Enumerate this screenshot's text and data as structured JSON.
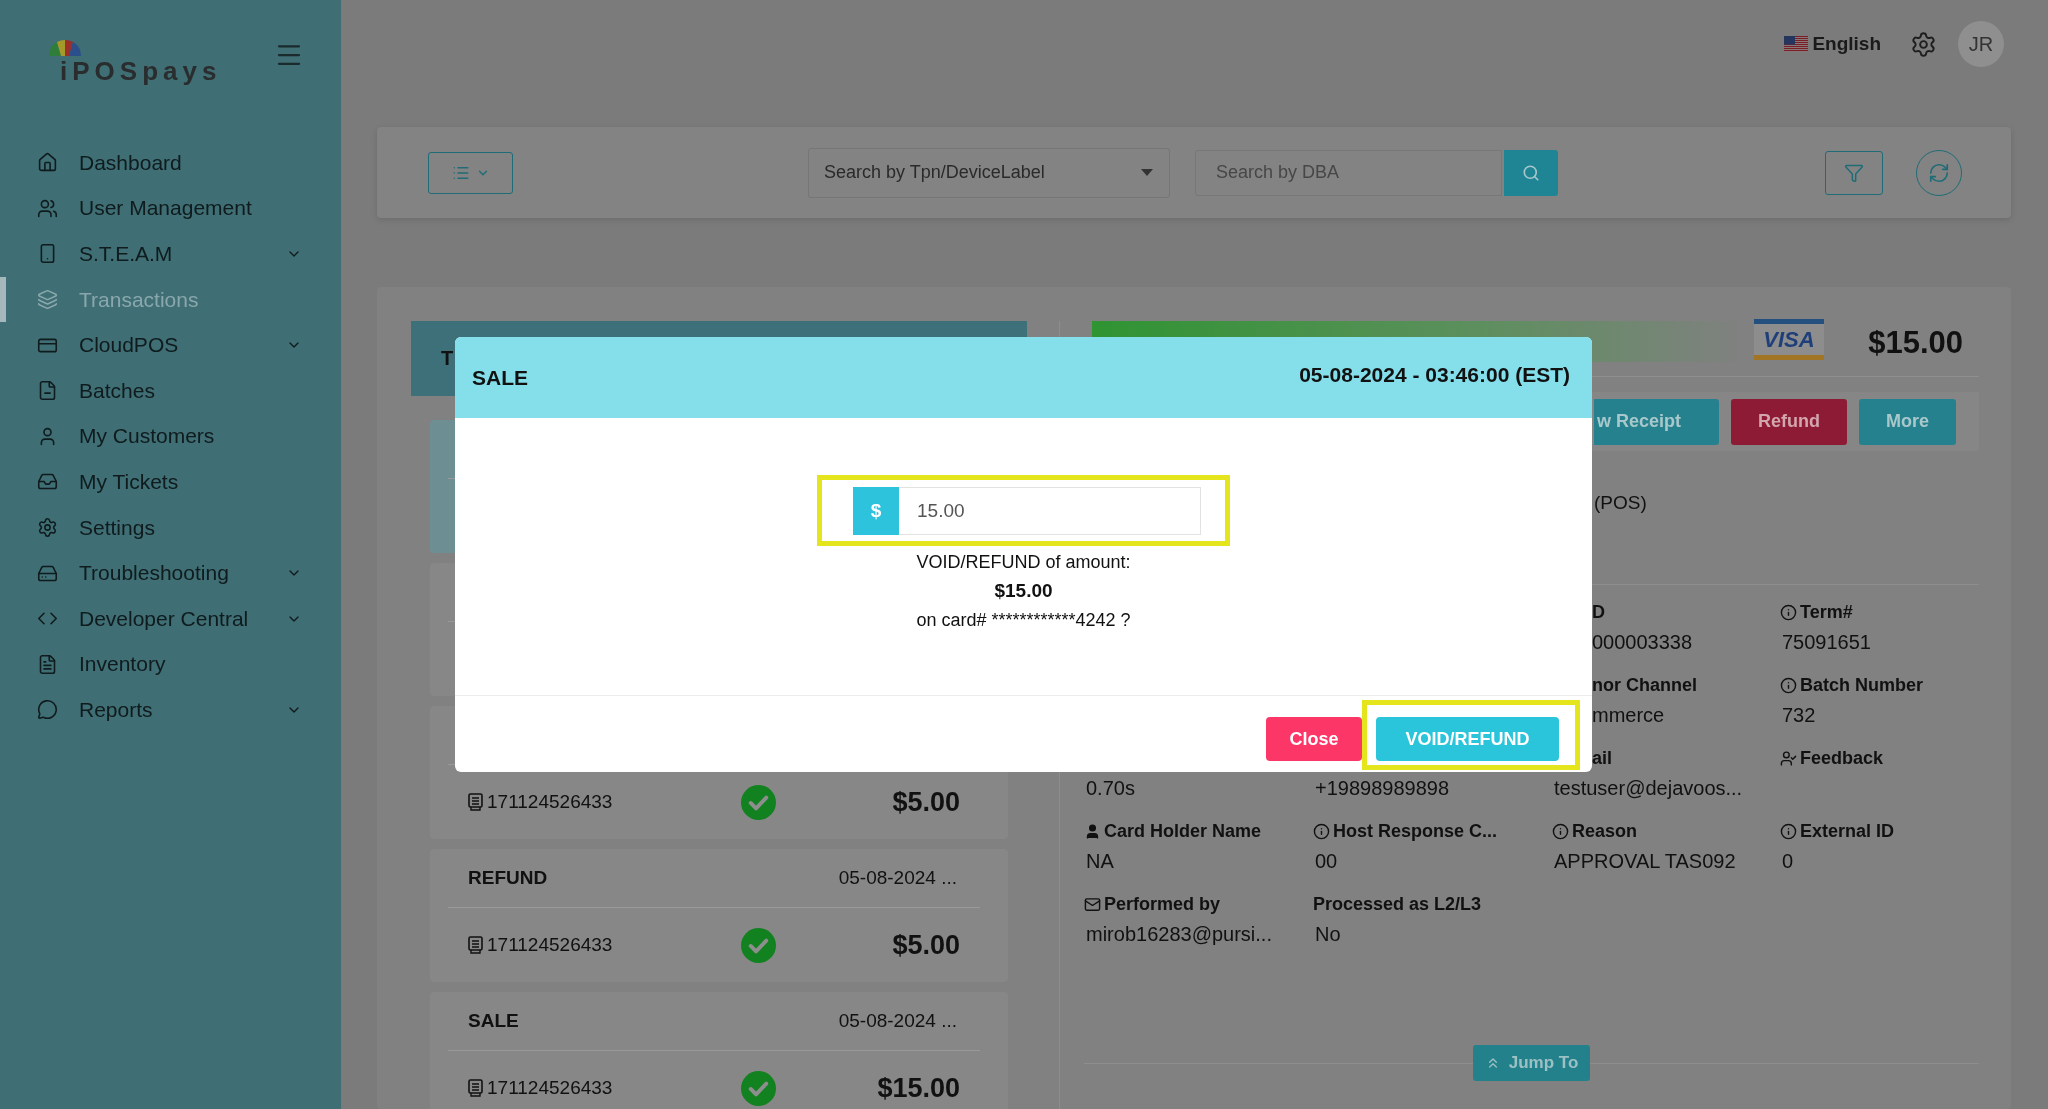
{
  "sidebar": {
    "logo": "iPOSpays",
    "items": [
      {
        "label": "Dashboard",
        "selected": false,
        "expandable": false
      },
      {
        "label": "User Management",
        "selected": false,
        "expandable": false
      },
      {
        "label": "S.T.E.A.M",
        "selected": false,
        "expandable": true
      },
      {
        "label": "Transactions",
        "selected": true,
        "expandable": false
      },
      {
        "label": "CloudPOS",
        "selected": false,
        "expandable": true
      },
      {
        "label": "Batches",
        "selected": false,
        "expandable": false
      },
      {
        "label": "My Customers",
        "selected": false,
        "expandable": false
      },
      {
        "label": "My Tickets",
        "selected": false,
        "expandable": false
      },
      {
        "label": "Settings",
        "selected": false,
        "expandable": false
      },
      {
        "label": "Troubleshooting",
        "selected": false,
        "expandable": true
      },
      {
        "label": "Developer Central",
        "selected": false,
        "expandable": true
      },
      {
        "label": "Inventory",
        "selected": false,
        "expandable": false
      },
      {
        "label": "Reports",
        "selected": false,
        "expandable": true
      }
    ]
  },
  "topbar": {
    "language": "English",
    "avatar": "JR"
  },
  "toolbar": {
    "device_select": {
      "placeholder": "Search by Tpn/DeviceLabel"
    },
    "dba_search": {
      "placeholder": "Search by DBA"
    }
  },
  "list_panel": {
    "tab": "T",
    "transactions": [
      {
        "selected": true
      },
      {
        "selected": false
      },
      {
        "selected": false,
        "id": "171124526433",
        "approved": true,
        "amount": "$5.00"
      },
      {
        "selected": false,
        "type": "REFUND",
        "date": "05-08-2024 ...",
        "id": "171124526433",
        "approved": true,
        "amount": "$5.00"
      },
      {
        "selected": false,
        "type": "SALE",
        "date": "05-08-2024 ...",
        "id": "171124526433",
        "approved": true,
        "amount": "$15.00"
      }
    ]
  },
  "detail": {
    "card_brand": "VISA",
    "amount": "$15.00",
    "actions": [
      {
        "label": "w Receipt",
        "kind": "primary"
      },
      {
        "label": "Refund",
        "kind": "danger"
      },
      {
        "label": "More",
        "kind": "primary"
      }
    ],
    "entry_mode": "(POS)",
    "rows": [
      [
        null,
        null,
        {
          "label": "D",
          "value": "000003338"
        },
        {
          "label": "Term#",
          "value": "75091651"
        }
      ],
      [
        null,
        null,
        {
          "label": "nor Channel",
          "value": "mmerce"
        },
        {
          "label": "Batch Number",
          "value": "732"
        }
      ],
      [
        {
          "value": "0.70s"
        },
        {
          "value": "+19898989898"
        },
        {
          "label": "ail",
          "value": "testuser@dejavoos..."
        },
        {
          "label": "Feedback"
        }
      ],
      [
        {
          "label": "Card Holder Name",
          "value": "NA"
        },
        {
          "label": "Host Response C...",
          "value": "00"
        },
        {
          "label": "Reason",
          "value": "APPROVAL TAS092"
        },
        {
          "label": "External ID",
          "value": "0"
        }
      ],
      [
        {
          "label": "Performed by",
          "value": "mirob16283@pursi..."
        },
        {
          "label": "Processed as L2/L3",
          "value": "No"
        }
      ]
    ],
    "jump_to": "Jump To"
  },
  "modal": {
    "title": "SALE",
    "datetime": "05-08-2024 - 03:46:00 (EST)",
    "amount_field": {
      "currency": "$",
      "value": "15.00",
      "highlighted": true
    },
    "prompt": "VOID/REFUND of amount:",
    "amount": "$15.00",
    "card_line": "on card# ************4242 ?",
    "buttons": [
      {
        "label": "Close",
        "kind": "cancel",
        "highlighted": false
      },
      {
        "label": "VOID/REFUND",
        "kind": "confirm",
        "highlighted": true
      }
    ]
  }
}
